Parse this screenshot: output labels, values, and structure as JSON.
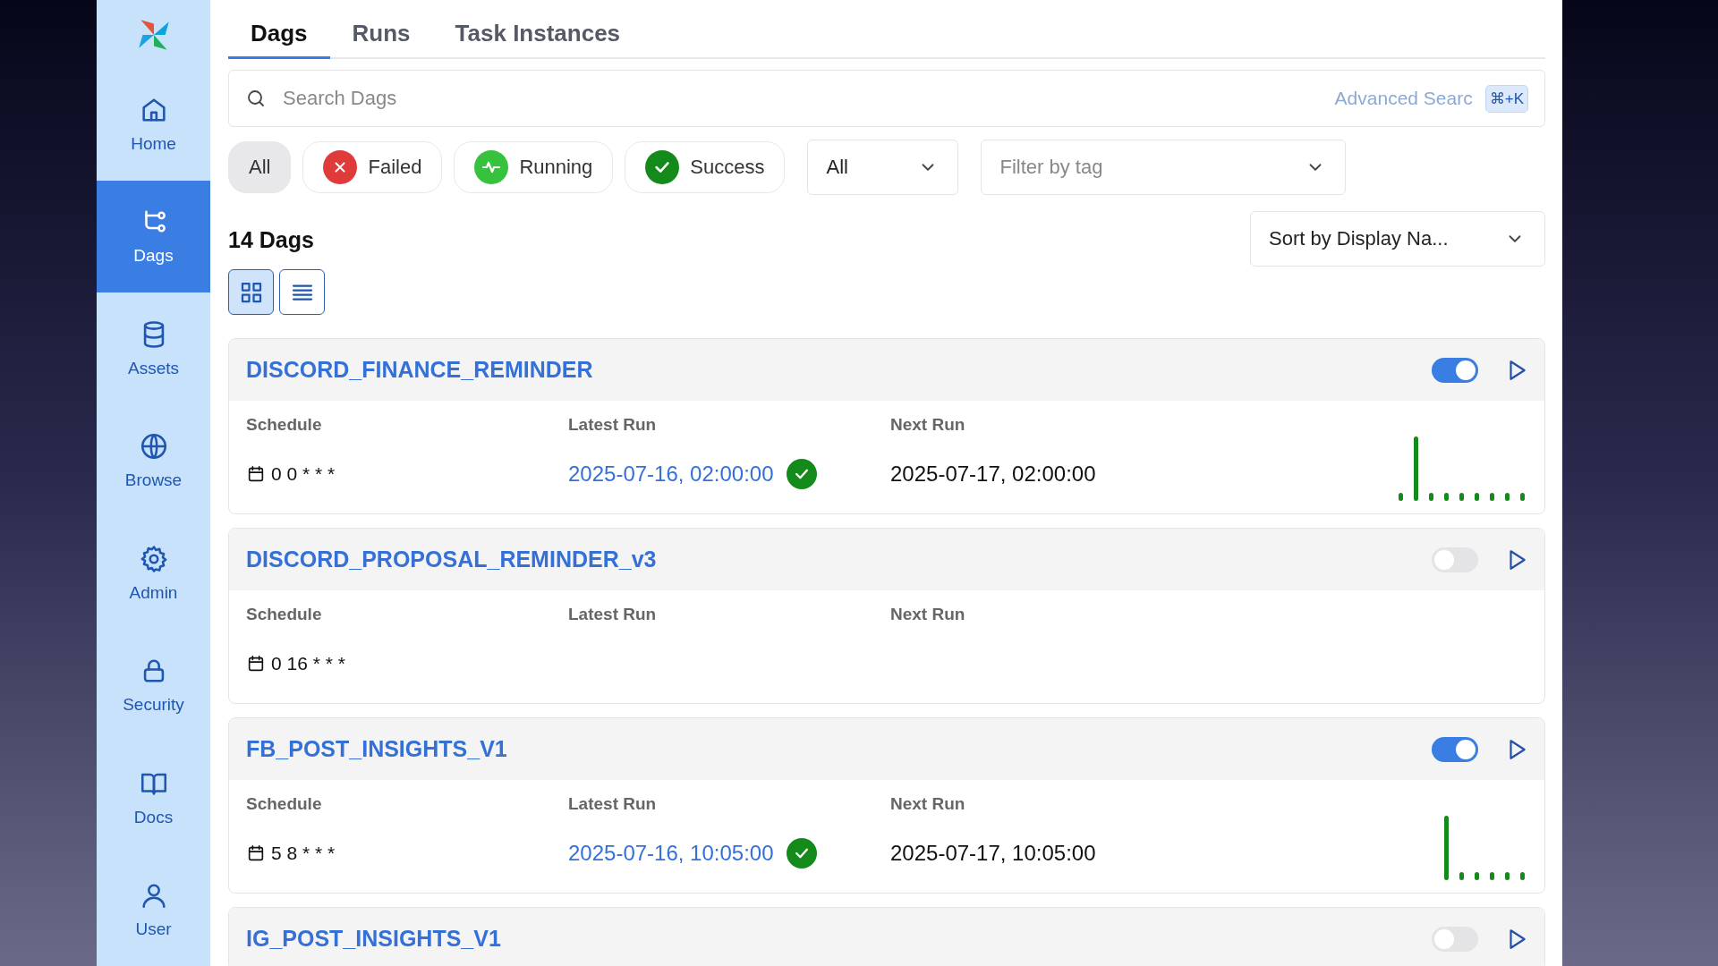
{
  "sidebar": {
    "items": [
      {
        "label": "Home",
        "selected": false
      },
      {
        "label": "Dags",
        "selected": true
      },
      {
        "label": "Assets",
        "selected": false
      },
      {
        "label": "Browse",
        "selected": false
      },
      {
        "label": "Admin",
        "selected": false
      },
      {
        "label": "Security",
        "selected": false
      },
      {
        "label": "Docs",
        "selected": false
      },
      {
        "label": "User",
        "selected": false
      }
    ]
  },
  "tabs": [
    {
      "label": "Dags",
      "selected": true
    },
    {
      "label": "Runs",
      "selected": false
    },
    {
      "label": "Task Instances",
      "selected": false
    }
  ],
  "search": {
    "placeholder": "Search Dags",
    "advanced": "Advanced Searc",
    "shortcut": "⌘+K"
  },
  "state_filters": [
    {
      "label": "All",
      "kind": "all",
      "selected": true
    },
    {
      "label": "Failed",
      "kind": "failed",
      "selected": false
    },
    {
      "label": "Running",
      "kind": "running",
      "selected": false
    },
    {
      "label": "Success",
      "kind": "success",
      "selected": false
    }
  ],
  "paused_filter": {
    "value": "All"
  },
  "tag_filter": {
    "placeholder": "Filter by tag"
  },
  "count": "14 Dags",
  "sort": {
    "value": "Sort by Display Na..."
  },
  "view_toggle": [
    {
      "kind": "grid",
      "selected": true
    },
    {
      "kind": "list",
      "selected": false
    }
  ],
  "dags": [
    {
      "name": "DISCORD_FINANCE_REMINDER",
      "on": true,
      "labels": [
        "Schedule",
        "Latest Run",
        "Next Run"
      ],
      "schedule": "0 0 * * *",
      "latest_run": "2025-07-16, 02:00:00",
      "latest_succeeded": true,
      "next_run": "2025-07-17, 02:00:00",
      "recent_runs": [
        {
          "long": false
        },
        {
          "long": true
        },
        {
          "long": false
        },
        {
          "long": false
        },
        {
          "long": false
        },
        {
          "long": false
        },
        {
          "long": false
        },
        {
          "long": false
        },
        {
          "long": false
        }
      ]
    },
    {
      "name": "DISCORD_PROPOSAL_REMINDER_v3",
      "on": false,
      "labels": [
        "Schedule",
        "Latest Run",
        "Next Run"
      ],
      "schedule": "0 16 * * *"
    },
    {
      "name": "FB_POST_INSIGHTS_V1",
      "on": true,
      "labels": [
        "Schedule",
        "Latest Run",
        "Next Run"
      ],
      "schedule": "5 8 * * *",
      "latest_run": "2025-07-16, 10:05:00",
      "latest_succeeded": true,
      "next_run": "2025-07-17, 10:05:00",
      "recent_runs": [
        {
          "long": true
        },
        {
          "long": false
        },
        {
          "long": false
        },
        {
          "long": false
        },
        {
          "long": false
        },
        {
          "long": false
        }
      ]
    },
    {
      "name": "IG_POST_INSIGHTS_V1",
      "on": false
    }
  ]
}
